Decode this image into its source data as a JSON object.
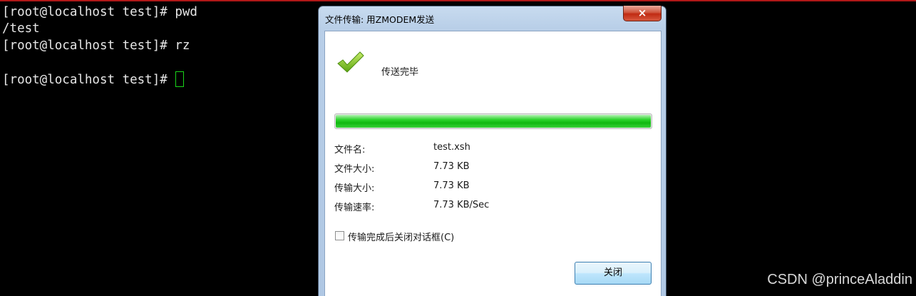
{
  "terminal": {
    "lines": [
      "[root@localhost test]# pwd",
      "/test",
      "[root@localhost test]# rz",
      "",
      "[root@localhost test]# "
    ],
    "cursor_color": "#19d419"
  },
  "dialog": {
    "title": "文件传输: 用ZMODEM发送",
    "close_icon": "×",
    "status": "传送完毕",
    "progress_fraction": 1.0,
    "info": [
      {
        "label": "文件名:",
        "value": "test.xsh"
      },
      {
        "label": "文件大小:",
        "value": "7.73 KB"
      },
      {
        "label": "传输大小:",
        "value": "7.73 KB"
      },
      {
        "label": "传输速率:",
        "value": "7.73 KB/Sec"
      }
    ],
    "checkbox_label": "传输完成后关闭对话框(C)",
    "checkbox_checked": false,
    "close_button": "关闭"
  },
  "watermark": "CSDN @princeAladdin"
}
